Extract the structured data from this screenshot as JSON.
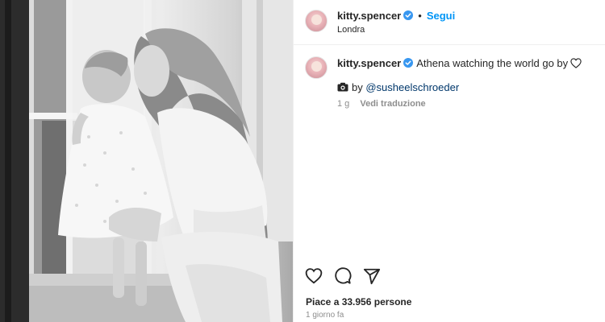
{
  "post": {
    "photo_alt": "",
    "header": {
      "username": "kitty.spencer",
      "follow_label": "Segui",
      "separator": "•",
      "location": "Londra"
    },
    "caption": {
      "username": "kitty.spencer",
      "text": "Athena watching the world go by",
      "credit_prefix": "by",
      "credit_mention": "@susheelschroeder",
      "age": "1 g",
      "translate_label": "Vedi traduzione"
    },
    "actions": [
      "heart-icon",
      "comment-icon",
      "share-icon"
    ],
    "likes_text": "Piace a 33.956 persone",
    "timestamp": "1 giorno fa"
  },
  "colors": {
    "accent": "#0095f6",
    "mention": "#00376b",
    "verified": "#3897f0",
    "secondary_text": "#8e8e8e"
  }
}
